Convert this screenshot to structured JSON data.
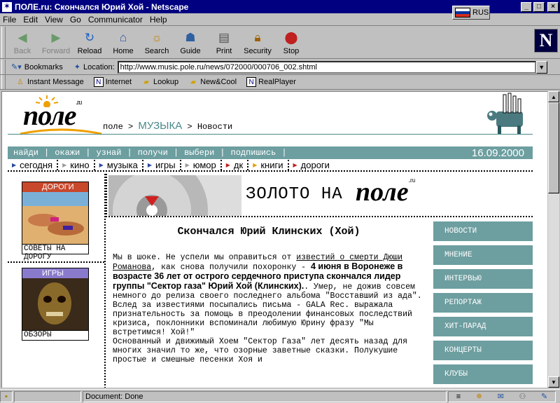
{
  "window": {
    "title": "ПОЛЕ.ru: Скончался Юрий Хой - Netscape",
    "lang_indicator": "RUS",
    "controls": [
      "_",
      "□",
      "×"
    ]
  },
  "menu": [
    "File",
    "Edit",
    "View",
    "Go",
    "Communicator",
    "Help"
  ],
  "toolbar": {
    "buttons": [
      {
        "label": "Back",
        "icon": "back-arrow-icon",
        "enabled": false
      },
      {
        "label": "Forward",
        "icon": "forward-arrow-icon",
        "enabled": false
      },
      {
        "label": "Reload",
        "icon": "reload-icon",
        "enabled": true
      },
      {
        "label": "Home",
        "icon": "home-icon",
        "enabled": true
      },
      {
        "label": "Search",
        "icon": "search-icon",
        "enabled": true
      },
      {
        "label": "Guide",
        "icon": "guide-icon",
        "enabled": true
      },
      {
        "label": "Print",
        "icon": "print-icon",
        "enabled": true
      },
      {
        "label": "Security",
        "icon": "lock-icon",
        "enabled": true
      },
      {
        "label": "Stop",
        "icon": "stop-icon",
        "enabled": true
      }
    ],
    "logo": "N"
  },
  "location": {
    "bookmarks_label": "Bookmarks",
    "label": "Location:",
    "url": "http://www.music.pole.ru/news/072000/000706_002.shtml"
  },
  "personal_toolbar": [
    "Instant Message",
    "Internet",
    "Lookup",
    "New&Cool",
    "RealPlayer"
  ],
  "status": {
    "text": "Document: Done"
  },
  "page": {
    "logo_text": "поле",
    "logo_sup": ".ru",
    "breadcrumb": {
      "root": "поле",
      "sep": ">",
      "section": "МУЗЫКА",
      "sub": "Новости"
    },
    "topnav": [
      "найди",
      "окажи",
      "узнай",
      "получи",
      "выбери",
      "подпишись"
    ],
    "date": "16.09.2000",
    "sections": [
      "сегодня",
      "кино",
      "музыка",
      "игры",
      "юмор",
      "дк",
      "книги",
      "дороги"
    ],
    "section_colors": [
      "#2a4aa0",
      "#9a9a9a",
      "#2a4aa0",
      "#2a4aa0",
      "#9a9a9a",
      "#c02020",
      "#e0a000",
      "#c02020"
    ],
    "banner_text": "ЗОЛОТО НА",
    "banner_logo": "поле",
    "banner_logo_sup": ".ru",
    "promos": [
      {
        "head": "ДОРОГИ",
        "foot": "СОВЕТЫ НА ДОРОГУ"
      },
      {
        "head": "ИГРЫ",
        "foot": "ОБЗОРЫ"
      }
    ],
    "article": {
      "title": "Скончался Юрий Клинских (Хой)",
      "p1_a": "Мы в шоке. Не успели мы оправиться от ",
      "p1_link": "известий о смерти Дюши Романова",
      "p1_b": ", как снова получили похоронку - ",
      "p1_bold": "4 июня в Воронеже в возрасте 36 лет от острого сердечного приступа скончался лидер группы \"Сектор газа\" Юрий Хой (Клинских).",
      "p1_c": ". Умер, не дожив совсем немного до релиза своего последнего альбома \"Восставший из ада\". Вслед за известиями посыпались письма - GALA Rec. выражала признательность за помощь в преодолении финансовых последствий кризиса, поклонники вспоминали любимую Юрину фразу \"Мы встретимся! Хой!\"",
      "p2": "Основанный и движимый Хоем \"Сектор Газа\" лет десять назад для многих значил то же, что озорные заветные сказки. Полукушие простые и смешные песенки Хоя и"
    },
    "rightnav": [
      "НОВОСТИ",
      "МНЕНИЕ",
      "ИНТЕРВЬЮ",
      "РЕПОРТАЖ",
      "ХИТ-ПАРАД",
      "КОНЦЕРТЫ",
      "КЛУБЫ"
    ]
  },
  "colors": {
    "titlebar": "#000080",
    "teal": "#6d9ea0",
    "promo_red": "#c8482c"
  }
}
